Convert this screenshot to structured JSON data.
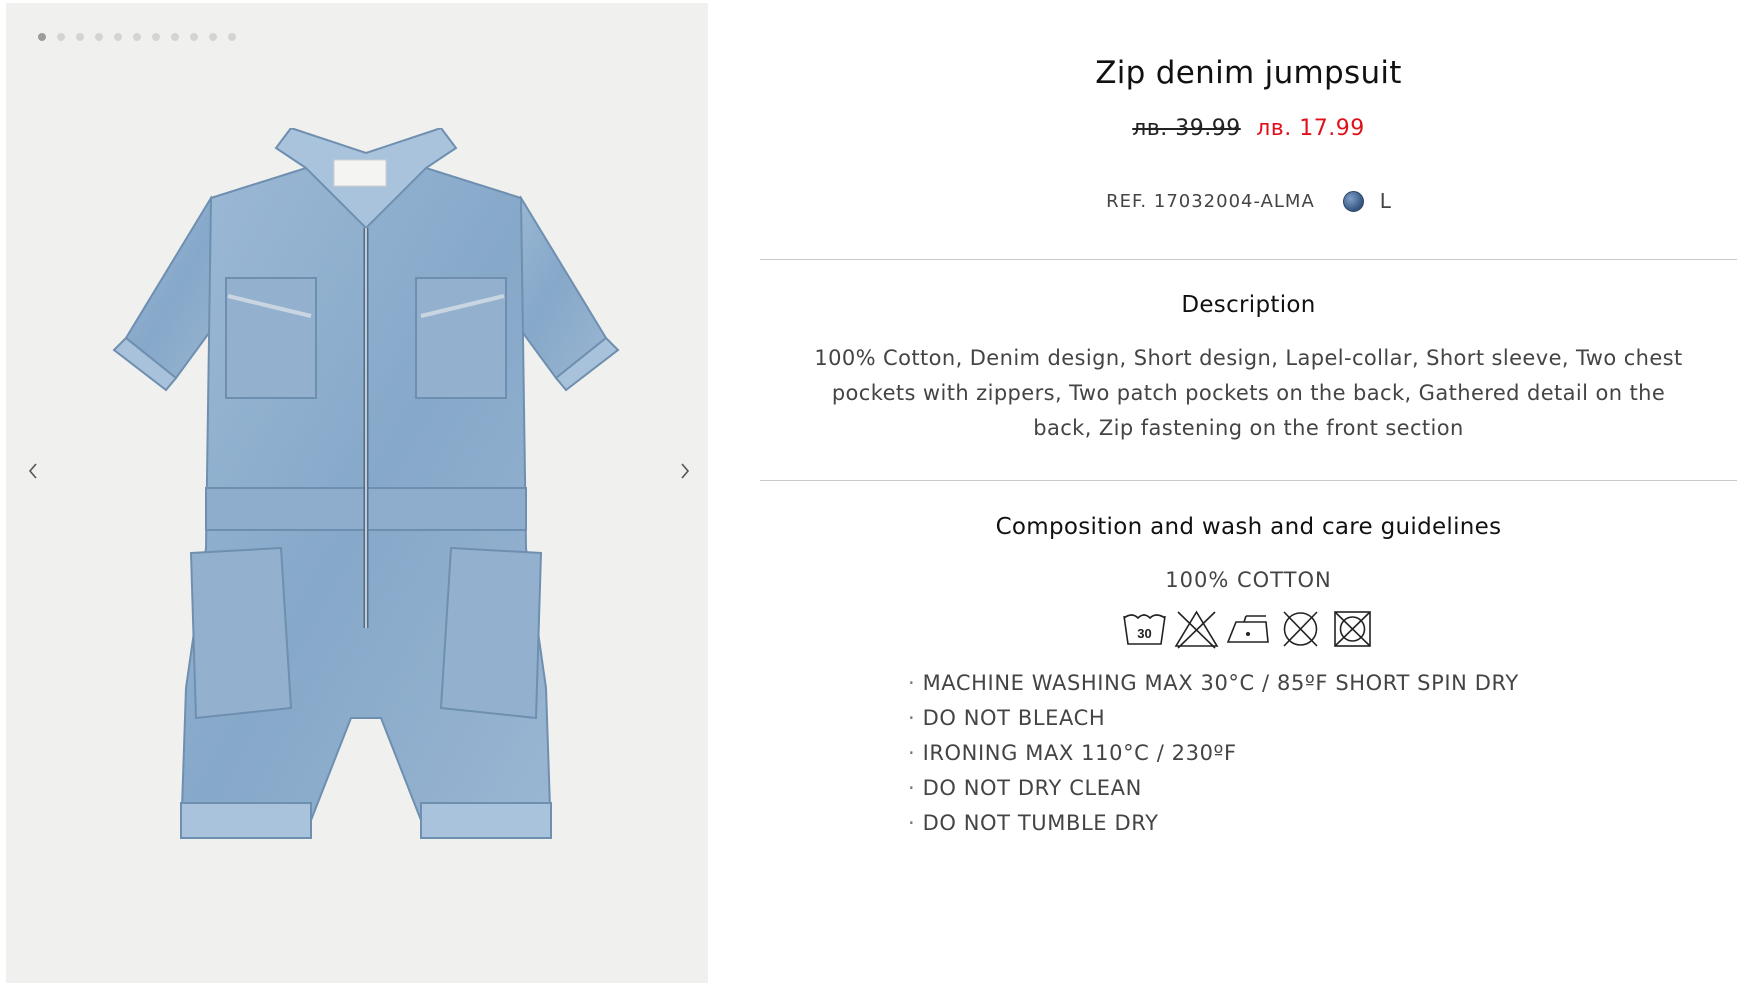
{
  "gallery": {
    "image_count": 11,
    "active_index": 0,
    "prev_icon": "chevron-left-icon",
    "next_icon": "chevron-right-icon"
  },
  "product": {
    "title": "Zip denim jumpsuit",
    "price_old": "лв. 39.99",
    "price_new": "лв. 17.99",
    "ref": "REF. 17032004-ALMA",
    "color_swatch": "#4a6d96",
    "size": "L"
  },
  "description": {
    "heading": "Description",
    "text": "100% Cotton, Denim design, Short design, Lapel-collar, Short sleeve, Two chest pockets with zippers, Two patch pockets on the back, Gathered detail on the back, Zip fastening on the front section"
  },
  "care": {
    "heading": "Composition and wash and care guidelines",
    "composition": "100% COTTON",
    "icons": [
      "wash-30-icon",
      "no-bleach-icon",
      "iron-low-icon",
      "no-dry-clean-icon",
      "no-tumble-dry-icon"
    ],
    "wash_temp_label": "30",
    "items": [
      "MACHINE WASHING MAX 30°C / 85ºF SHORT SPIN DRY",
      "DO NOT BLEACH",
      "IRONING MAX 110°C / 230ºF",
      "DO NOT DRY CLEAN",
      "DO NOT TUMBLE DRY"
    ]
  },
  "colors": {
    "sale_price": "#e0111b",
    "gallery_bg": "#f0f0ee",
    "denim": "#8fb0cf"
  }
}
